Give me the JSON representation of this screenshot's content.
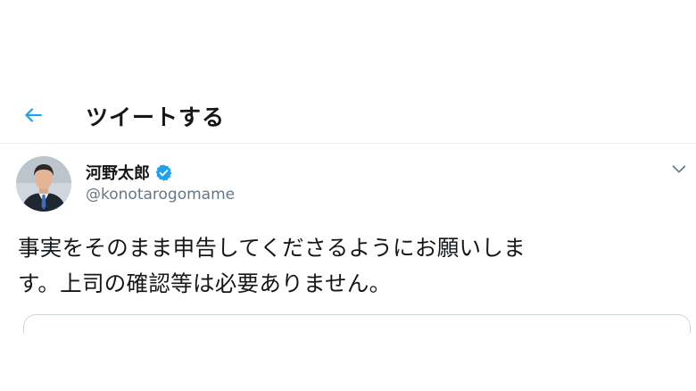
{
  "header": {
    "title": "ツイートする",
    "back_icon": "arrow-left-icon"
  },
  "tweet": {
    "author_name": "河野太郎",
    "author_handle": "@konotarogomame",
    "verified": true,
    "text_line1": "事実をそのまま申告してくださるようにお願いしま",
    "text_line2": "す。上司の確認等は必要ありません。"
  },
  "colors": {
    "accent": "#1da1f2",
    "text": "#14171a",
    "secondary": "#657786",
    "divider": "#e6ecf0"
  }
}
